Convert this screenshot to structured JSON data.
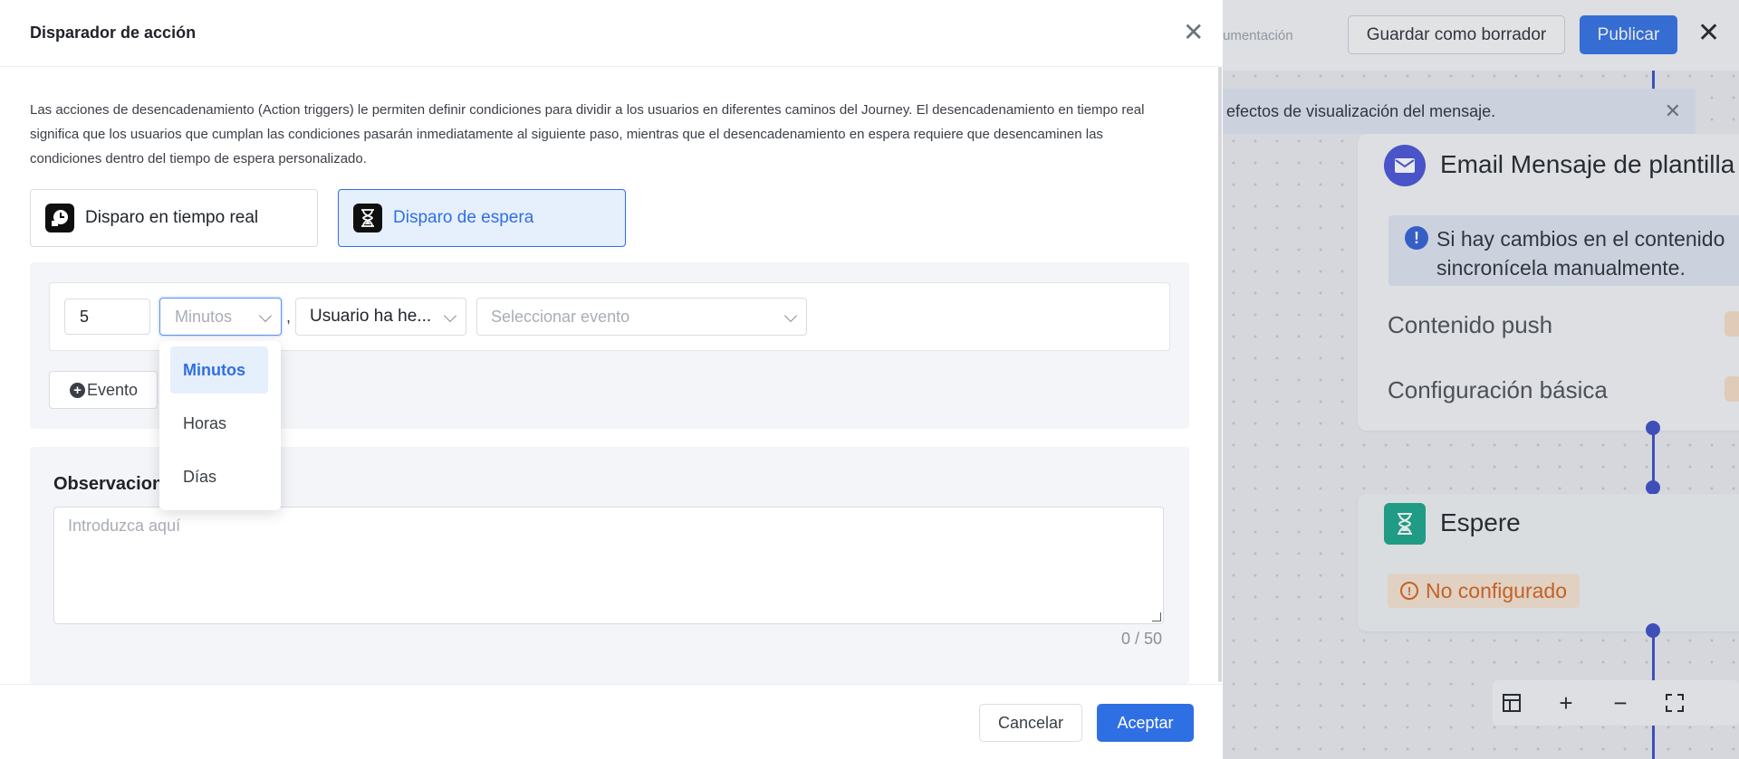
{
  "canvas": {
    "doc_link": "umentación",
    "save_draft": "Guardar como borrador",
    "publish": "Publicar",
    "notice_text": "efectos de visualización del mensaje.",
    "email_card": {
      "title": "Email Mensaje de plantilla",
      "info_line1": "Si hay cambios en el contenido",
      "info_line2": "sincronícela manualmente.",
      "rows": [
        "Contenido push",
        "Configuración básica"
      ]
    },
    "wait_card": {
      "title": "Espere",
      "status": "No configurado"
    }
  },
  "drawer": {
    "title": "Disparador de acción",
    "description": "Las acciones de desencadenamiento (Action triggers) le permiten definir condiciones para dividir a los usuarios en diferentes caminos del Journey. El desencadenamiento en tiempo real significa que los usuarios que cumplan las condiciones pasarán inmediatamente al siguiente paso, mientras que el desencadenamiento en espera requiere que desencaminen las condiciones dentro del tiempo de espera personalizado.",
    "modes": {
      "realtime": "Disparo en tiempo real",
      "wait": "Disparo de espera"
    },
    "condition": {
      "number_value": "5",
      "unit_placeholder": "Minutos",
      "separator": ",",
      "user_action": "Usuario ha he...",
      "event_placeholder": "Seleccionar evento"
    },
    "add_event": "Evento",
    "unit_options": [
      "Minutos",
      "Horas",
      "Días"
    ],
    "unit_selected": "Minutos",
    "observations_label": "Observacion",
    "observations_placeholder": "Introduzca aquí",
    "counter": "0 / 50",
    "cancel": "Cancelar",
    "accept": "Aceptar"
  },
  "colors": {
    "primary": "#2f6fe4",
    "primary_light": "#e6effc",
    "flow_line": "#3b4cc6",
    "email_icon": "#4552d8",
    "wait_icon": "#17a589",
    "warning": "#d4621a"
  }
}
